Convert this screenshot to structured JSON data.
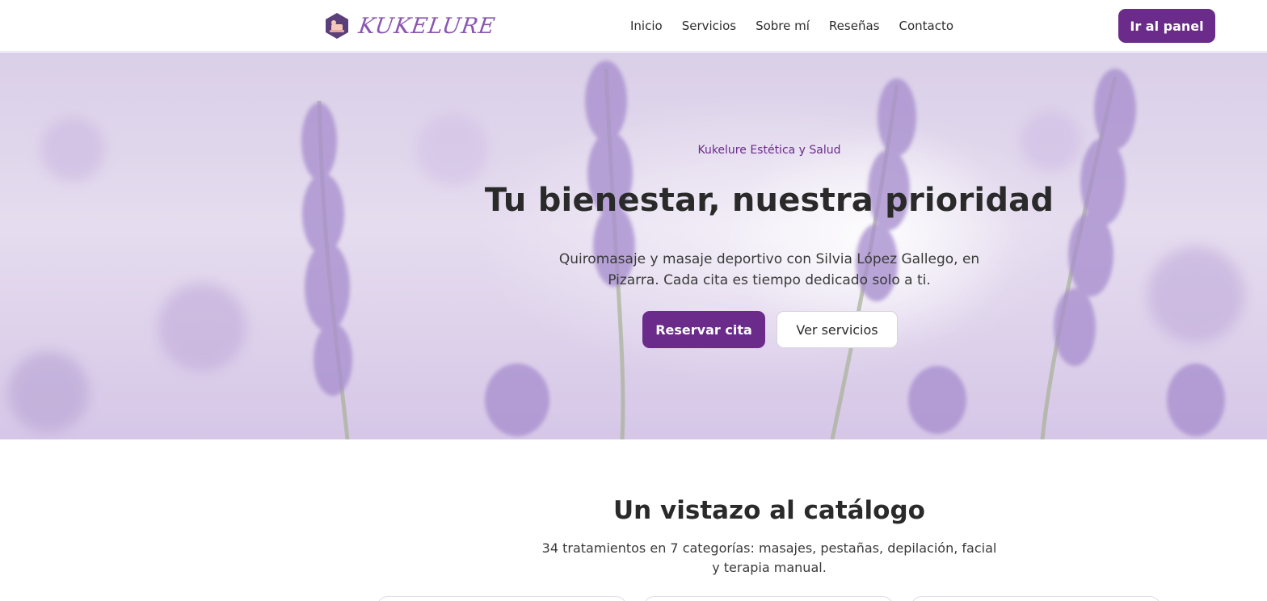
{
  "brand": {
    "name": "KUKELURE",
    "accent_color": "#6a2b8a",
    "logo_icon": "hexagon-spa-icon"
  },
  "nav": {
    "items": [
      {
        "label": "Inicio"
      },
      {
        "label": "Servicios"
      },
      {
        "label": "Sobre mí"
      },
      {
        "label": "Reseñas"
      },
      {
        "label": "Contacto"
      }
    ],
    "panel_button": "Ir al panel"
  },
  "hero": {
    "eyebrow": "Kukelure Estética y Salud",
    "title": "Tu bienestar, nuestra prioridad",
    "subtitle": "Quiromasaje y masaje deportivo con Silvia López Gallego, en Pizarra. Cada cita es tiempo dedicado solo a ti.",
    "primary_button": "Reservar cita",
    "secondary_button": "Ver servicios"
  },
  "catalog": {
    "title": "Un vistazo al catálogo",
    "subtitle": "34 tratamientos en 7 categorías: masajes, pestañas, depilación, facial y terapia manual."
  }
}
